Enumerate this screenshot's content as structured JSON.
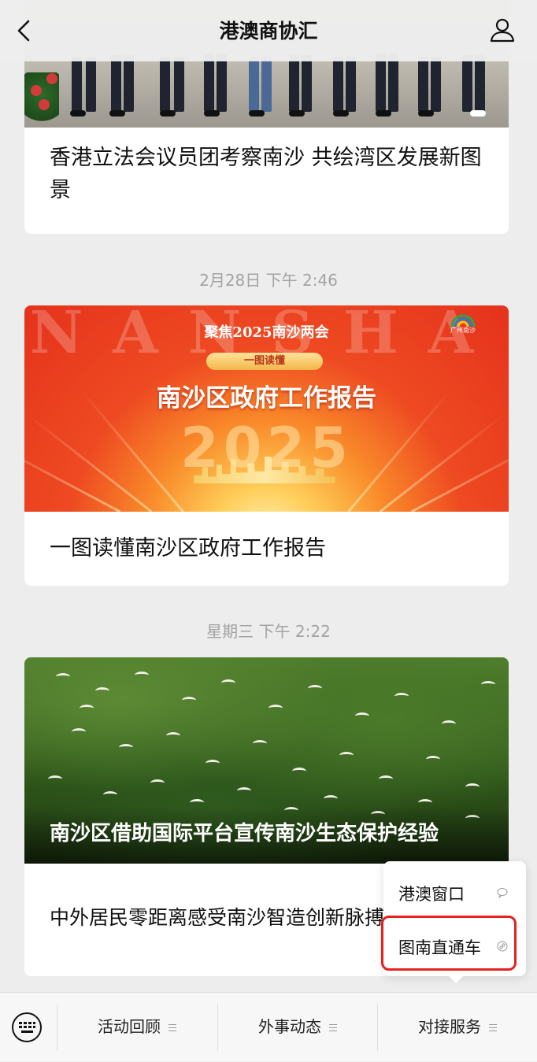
{
  "nav": {
    "title": "港澳商协汇"
  },
  "feed": [
    {
      "title": "香港立法会议员团考察南沙 共绘湾区发展新图景"
    },
    {
      "timestamp": "2月28日 下午 2:46",
      "title": "一图读懂南沙区政府工作报告",
      "image": {
        "bg_text": "NANSHA",
        "subtitle": "聚焦2025南沙两会",
        "pill": "一图读懂",
        "headline": "南沙区政府工作报告",
        "year": "2025",
        "logo_text": "广州南沙"
      }
    },
    {
      "timestamp": "星期三 下午 2:22",
      "caption": "南沙区借助国际平台宣传南沙生态保护经验",
      "title": "中外居民零距离感受南沙智造创新脉搏"
    }
  ],
  "popup": {
    "items": [
      {
        "label": "港澳窗口",
        "icon": "chat-bubble-icon"
      },
      {
        "label": "图南直通车",
        "icon": "mini-program-icon",
        "highlighted": true
      }
    ]
  },
  "bottom_menu": {
    "items": [
      {
        "label": "活动回顾"
      },
      {
        "label": "外事动态"
      },
      {
        "label": "对接服务"
      }
    ]
  },
  "colors": {
    "highlight": "#e5201e",
    "background": "#ededed"
  }
}
